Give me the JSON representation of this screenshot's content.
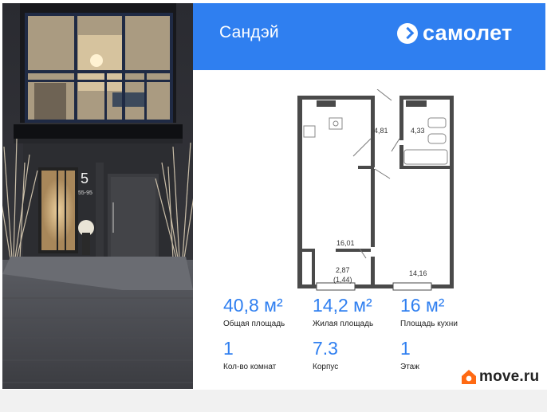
{
  "header": {
    "project_name": "Сандэй",
    "brand_name": "самолет",
    "accent_color": "#2f7ff0"
  },
  "photo": {
    "entrance_number": "5",
    "entrance_range": "55-95"
  },
  "plan": {
    "rooms": [
      {
        "label": "4,81"
      },
      {
        "label": "4,33"
      },
      {
        "label": "16,01"
      },
      {
        "label": "2,87"
      },
      {
        "label": "(1,44)"
      },
      {
        "label": "14,16"
      }
    ]
  },
  "stats": {
    "total_area": {
      "value": "40,8 м²",
      "label": "Общая площадь"
    },
    "living_area": {
      "value": "14,2 м²",
      "label": "Жилая площадь"
    },
    "kitchen_area": {
      "value": "16 м²",
      "label": "Площадь кухни"
    },
    "rooms": {
      "value": "1",
      "label": "Кол-во комнат"
    },
    "building": {
      "value": "7.3",
      "label": "Корпус"
    },
    "floor": {
      "value": "1",
      "label": "Этаж"
    }
  },
  "footer": {
    "logo_text": "move.ru",
    "logo_color": "#ff6a13",
    "icon": "house-icon"
  }
}
